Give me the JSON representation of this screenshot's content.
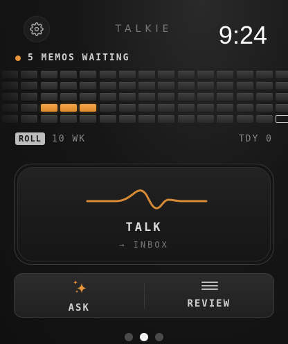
{
  "header": {
    "app_title": "TALKIE",
    "clock": "9:24",
    "settings_icon": "gear-icon"
  },
  "status": {
    "text": "5 MEMOS WAITING",
    "dot_color": "#e8953a"
  },
  "activity_grid": {
    "rows": 5,
    "weeks_visible": 15,
    "active_cells": [
      [
        3,
        2
      ],
      [
        3,
        3
      ],
      [
        3,
        4
      ]
    ],
    "today_cell": [
      4,
      14
    ],
    "accent_color": "#e8953a"
  },
  "range": {
    "roll_label": "ROLL",
    "range_label": "10 WK",
    "today_label": "TDY 0"
  },
  "talk_card": {
    "label": "TALK",
    "sub_label": "→ INBOX",
    "icon": "waveform-icon",
    "wave_color": "#d68a35"
  },
  "bottom_bar": {
    "ask_label": "ASK",
    "ask_icon": "sparkles-icon",
    "review_label": "REVIEW",
    "review_icon": "list-lines-icon"
  },
  "pager": {
    "count": 3,
    "active_index": 1
  }
}
